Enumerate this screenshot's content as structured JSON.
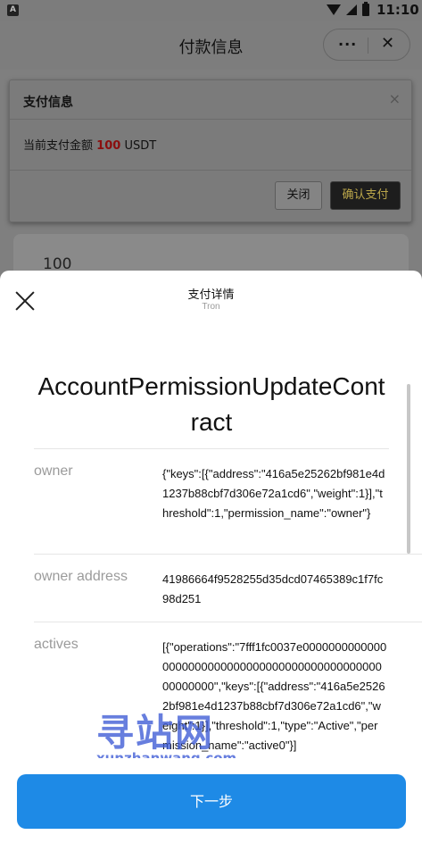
{
  "status_bar": {
    "app_icon_letter": "A",
    "time": "11:10"
  },
  "app_header": {
    "title": "付款信息",
    "more_label": "···",
    "close_label": "✕"
  },
  "payment_dialog": {
    "title": "支付信息",
    "close_label": "×",
    "amount_prefix": "当前支付金额",
    "amount_value": "100",
    "amount_unit": "USDT",
    "cancel_label": "关闭",
    "confirm_label": "确认支付"
  },
  "peek_card": {
    "value": "100"
  },
  "sheet": {
    "title": "支付详情",
    "subtitle": "Tron",
    "contract_name": "AccountPermissionUpdateContract",
    "rows": [
      {
        "label": "owner",
        "value": "{\"keys\":[{\"address\":\"416a5e25262bf981e4d1237b88cbf7d306e72a1cd6\",\"weight\":1}],\"threshold\":1,\"permission_name\":\"owner\"}"
      },
      {
        "label": "owner address",
        "value": "41986664f9528255d35dcd07465389c1f7fc98d251"
      },
      {
        "label": "actives",
        "value": "[{\"operations\":\"7fff1fc0037e0000000000000000000000000000000000000000000000000000000\",\"keys\":[{\"address\":\"416a5e25262bf981e4d1237b88cbf7d306e72a1cd6\",\"weight\":1}],\"threshold\":1,\"type\":\"Active\",\"permission_name\":\"active0\"}]"
      }
    ],
    "next_label": "下一步"
  },
  "watermark": {
    "cn": "寻站网",
    "en": "xunzhanwang.com"
  },
  "colors": {
    "primary": "#1e8ae6",
    "amount_red": "#8b0e0e",
    "confirm_bg": "#1d1d1d",
    "confirm_text": "#bba64a",
    "label_gray": "#9b9b9b"
  }
}
